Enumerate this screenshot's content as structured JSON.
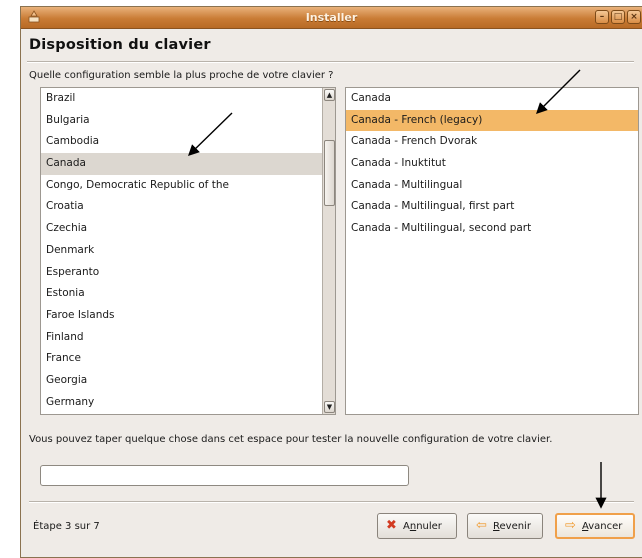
{
  "window": {
    "title": "Installer"
  },
  "page": {
    "heading": "Disposition du clavier",
    "question": "Quelle configuration semble la plus proche de votre clavier ?",
    "hint": "Vous pouvez taper quelque chose dans cet espace pour tester la nouvelle configuration de votre clavier."
  },
  "countries": {
    "items": [
      "Brazil",
      "Bulgaria",
      "Cambodia",
      "Canada",
      "Congo, Democratic Republic of the",
      "Croatia",
      "Czechia",
      "Denmark",
      "Esperanto",
      "Estonia",
      "Faroe Islands",
      "Finland",
      "France",
      "Georgia",
      "Germany"
    ],
    "selected": "Canada"
  },
  "variants": {
    "items": [
      "Canada",
      "Canada - French (legacy)",
      "Canada - French Dvorak",
      "Canada - Inuktitut",
      "Canada - Multilingual",
      "Canada - Multilingual, first part",
      "Canada - Multilingual, second part"
    ],
    "selected": "Canada - French (legacy)"
  },
  "test_input": {
    "value": ""
  },
  "footer": {
    "step": "Étape 3 sur 7",
    "cancel_prefix": "A",
    "cancel_mnemonic": "n",
    "cancel_rest": "nuler",
    "back_mnemonic": "R",
    "back_rest": "evenir",
    "next_mnemonic": "A",
    "next_rest": "vancer"
  },
  "icons": {
    "app": "ubuntu-installer-icon",
    "minimize": "minimize-icon",
    "maximize": "maximize-icon",
    "close": "close-icon",
    "cancel": "cancel-x-icon",
    "back": "back-arrow-icon",
    "next": "forward-arrow-icon"
  },
  "colors": {
    "titlebar": "#c97c35",
    "selected_variant": "#f3b867",
    "selected_country": "#dcd7d0",
    "default_button_border": "#f0a04a"
  }
}
